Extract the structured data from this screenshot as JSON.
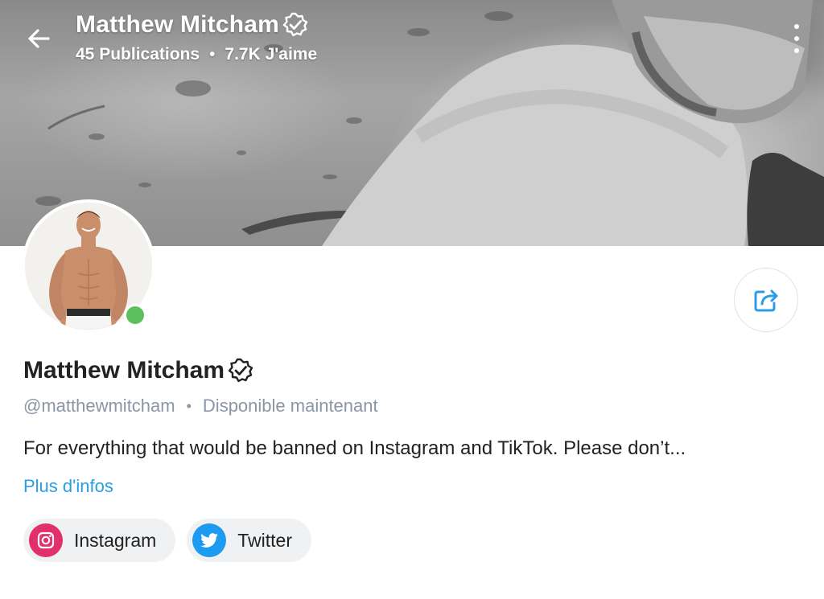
{
  "header": {
    "title": "Matthew Mitcham",
    "publications": "45 Publications",
    "likes": "7.7K J'aime",
    "separator": "•"
  },
  "profile": {
    "name": "Matthew Mitcham",
    "handle": "@matthewmitcham",
    "separator": "•",
    "status": "Disponible maintenant",
    "bio": "For everything that would be banned on Instagram and TikTok. Please don’t...",
    "more_link": "Plus d'infos",
    "online": true
  },
  "socials": [
    {
      "label": "Instagram",
      "icon": "instagram-icon",
      "color": "#e1306c"
    },
    {
      "label": "Twitter",
      "icon": "twitter-icon",
      "color": "#1d9bf0"
    }
  ],
  "colors": {
    "accent": "#2a9de6",
    "online": "#5cc15c",
    "muted_text": "#8a96a3"
  }
}
